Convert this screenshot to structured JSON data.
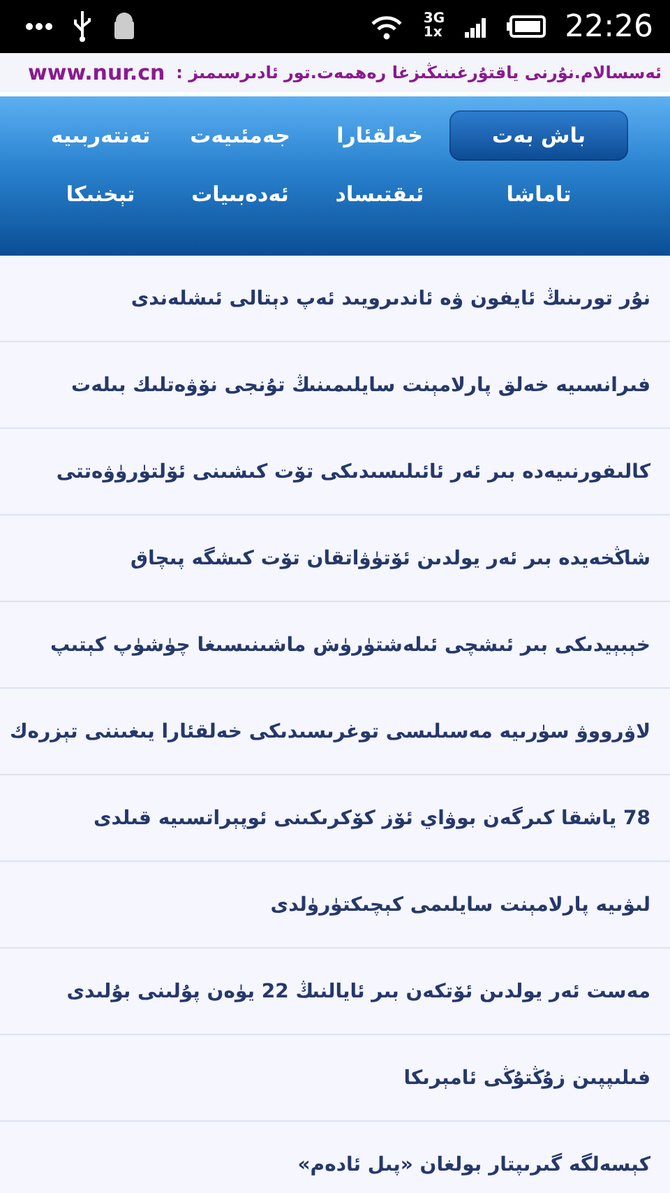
{
  "status_bar": {
    "network_top": "3G",
    "network_bottom": "1x",
    "time": "22:26"
  },
  "banner": {
    "message": "ئەسسالام.نۇرنى ياقتۇرغىنىڭىزغا رەھمەت.تور ئادىرسىمىز :",
    "url": "www.nur.cn"
  },
  "nav": [
    {
      "label": "باش بەت",
      "selected": true
    },
    {
      "label": "خەلقئارا",
      "selected": false
    },
    {
      "label": "جەمئىيەت",
      "selected": false
    },
    {
      "label": "تەنتەربىيە",
      "selected": false
    },
    {
      "label": "تاماشا",
      "selected": false
    },
    {
      "label": "ئىقتىساد",
      "selected": false
    },
    {
      "label": "ئەدەبىيات",
      "selected": false
    },
    {
      "label": "تېخنىكا",
      "selected": false
    }
  ],
  "articles": [
    "نۇر تورىنىڭ ئايفون ۋە ئاندىرويىد ئەپ دېتالى ئىشلەندى",
    "فىرانسىيە خەلق پارلامېنت سايلىمىنىڭ تۇنجى نۆۋەتلىك بىلەت",
    "كالىفورنىيەدە بىر ئەر ئائىلىسىدىكى تۆت كىشىنى ئۆلتۈرۈۋەتتى",
    "شاڭخەيدە بىر ئەر يولدىن ئۆتۈۋاتقان تۆت كىشگە پىچاق",
    "خېبېيدىكى بىر ئىشچى ئىلەشتۈرۈش ماشىنىسىغا چۈشۈپ كېتىپ",
    "لاۋرووۋ سۈرىيە مەسىلىسى توغرىسىدىكى خەلقئارا يىغىننى تېزرەك",
    "78 ياشقا كىرگەن بوۋاي ئۆز كۆكرىكىنى ئوپېراتسىيە قىلدى",
    "لىۋىيە پارلامېنت سايلىمى كېچىكتۈرۈلدى",
    "مەست ئەر يولدىن ئۆتكەن بىر ئايالنىڭ 22 يۈەن پۇلىنى بۇلىدى",
    "فىلىپپىن زۇڭتۇڭى ئامېرىكا",
    "كېسەلگە گىرىپتار بولغان «پىل ئادەم»"
  ]
}
